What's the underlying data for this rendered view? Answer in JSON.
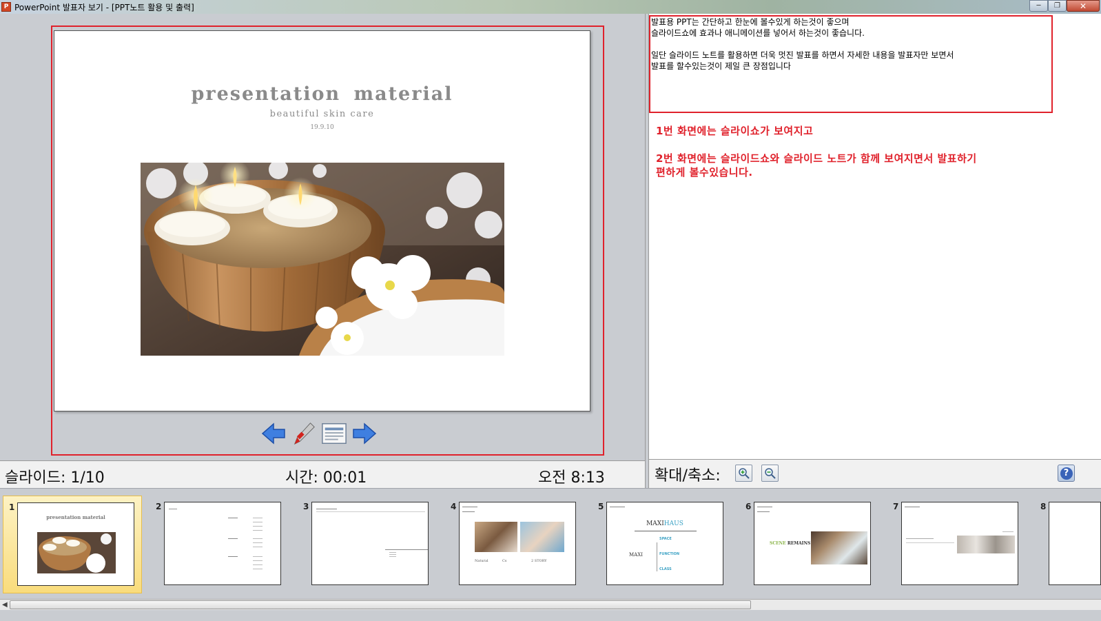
{
  "window": {
    "title": "PowerPoint 발표자 보기 - [PPT노트 활용 및 출력]",
    "app_icon": "powerpoint-icon",
    "minimize": "─",
    "restore": "❐",
    "close": "✕"
  },
  "slide": {
    "title": "presentation  material",
    "subtitle": "beautiful skin care",
    "date": "19.9.10"
  },
  "controls": [
    "previous-arrow-icon",
    "pen-icon",
    "slide-menu-icon",
    "next-arrow-icon"
  ],
  "status": {
    "slide_counter": "슬라이드: 1/10",
    "elapsed": "시간: 00:01",
    "clock": "오전 8:13"
  },
  "notes": {
    "text": "발표용 PPT는 간단하고 한눈에 볼수있게 하는것이 좋으며\n슬라이드쇼에 효과나 애니메이션를 넣어서 하는것이 좋습니다.\n\n일단 슬라이드 노트를 활용하면 더욱 멋진 발표를 하면서 자세한 내용을 발표자만 보면서\n발표를 할수있는것이 제일 큰 장점입니다",
    "annotation": "1번 화면에는 슬라이쇼가 보여지고\n\n2번 화면에는 슬라이드쇼와 슬라이드 노트가 함께 보여지면서 발표하기\n편하게 볼수있습니다."
  },
  "zoom": {
    "label": "확대/축소:",
    "zoom_in_icon": "zoom-in-icon",
    "zoom_out_icon": "zoom-out-icon",
    "help_label": "?"
  },
  "thumbnails": [
    {
      "num": "1",
      "title": "presentation  material",
      "active": true
    },
    {
      "num": "2"
    },
    {
      "num": "3"
    },
    {
      "num": "4",
      "caption_left": "Natural",
      "caption_mid": "Cs",
      "caption_right": "2 STORY"
    },
    {
      "num": "5",
      "brand_a": "MAXI",
      "brand_b": "HAUS",
      "side": "MAXI",
      "items": [
        "SPACE",
        "FUNCTION",
        "CLASS"
      ]
    },
    {
      "num": "6",
      "heading_a": "SCENE ",
      "heading_b": "REMAINS"
    },
    {
      "num": "7"
    },
    {
      "num": "8"
    }
  ],
  "colors": {
    "accent_red": "#e0212b",
    "panel_bg": "#c9ccd1",
    "active_thumb": "#f9dc7c"
  }
}
